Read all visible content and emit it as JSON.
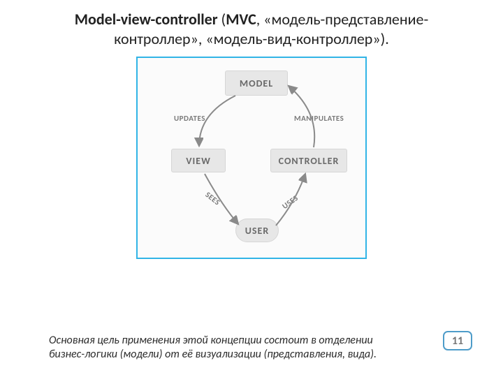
{
  "title": {
    "bold_prefix": "Model-view-controller",
    "light1": " (",
    "bold_mvc": "MVC",
    "light_rest": ", «модель-представление-контроллер», «модель-вид-контроллер»)."
  },
  "diagram": {
    "nodes": {
      "model": "MODEL",
      "view": "VIEW",
      "controller": "CONTROLLER",
      "user": "USER"
    },
    "edges": {
      "updates": "UPDATES",
      "manipulates": "MANIPULATES",
      "sees": "SEES",
      "uses": "USES"
    }
  },
  "footnote": "Основная цель применения этой концепции состоит в отделении бизнес-логики (модели) от её визуализации (представления, вида).",
  "page_number": "11"
}
